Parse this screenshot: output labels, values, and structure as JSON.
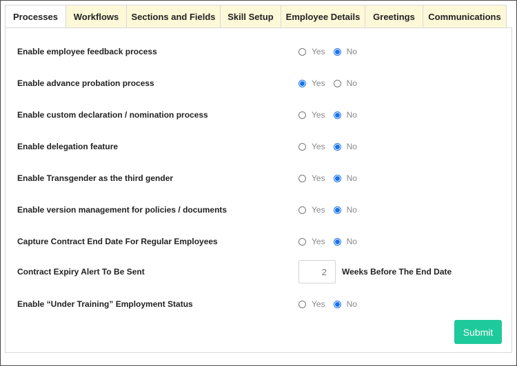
{
  "tabs": [
    {
      "label": "Processes",
      "active": true
    },
    {
      "label": "Workflows",
      "active": false
    },
    {
      "label": "Sections and Fields",
      "active": false
    },
    {
      "label": "Skill Setup",
      "active": false
    },
    {
      "label": "Employee Details",
      "active": false
    },
    {
      "label": "Greetings",
      "active": false
    },
    {
      "label": "Communications",
      "active": false
    }
  ],
  "settings": [
    {
      "label": "Enable employee feedback process",
      "yes_label": "Yes",
      "no_label": "No",
      "selected": "no"
    },
    {
      "label": "Enable advance probation process",
      "yes_label": "Yes",
      "no_label": "No",
      "selected": "yes"
    },
    {
      "label": "Enable custom declaration / nomination process",
      "yes_label": "Yes",
      "no_label": "No",
      "selected": "no"
    },
    {
      "label": "Enable delegation feature",
      "yes_label": "Yes",
      "no_label": "No",
      "selected": "no"
    },
    {
      "label": "Enable Transgender as the third gender",
      "yes_label": "Yes",
      "no_label": "No",
      "selected": "no"
    },
    {
      "label": "Enable version management for policies / documents",
      "yes_label": "Yes",
      "no_label": "No",
      "selected": "no"
    },
    {
      "label": "Capture Contract End Date For Regular Employees",
      "yes_label": "Yes",
      "no_label": "No",
      "selected": "no"
    }
  ],
  "contract_alert": {
    "label": "Contract Expiry Alert To Be Sent",
    "value": "2",
    "suffix": "Weeks Before The End Date"
  },
  "training_status": {
    "label": "Enable “Under Training” Employment Status",
    "yes_label": "Yes",
    "no_label": "No",
    "selected": "no"
  },
  "submit_label": "Submit",
  "colors": {
    "accent": "#1a73e8",
    "submit": "#1ec99b",
    "tab_bg": "#fdf8d8"
  }
}
